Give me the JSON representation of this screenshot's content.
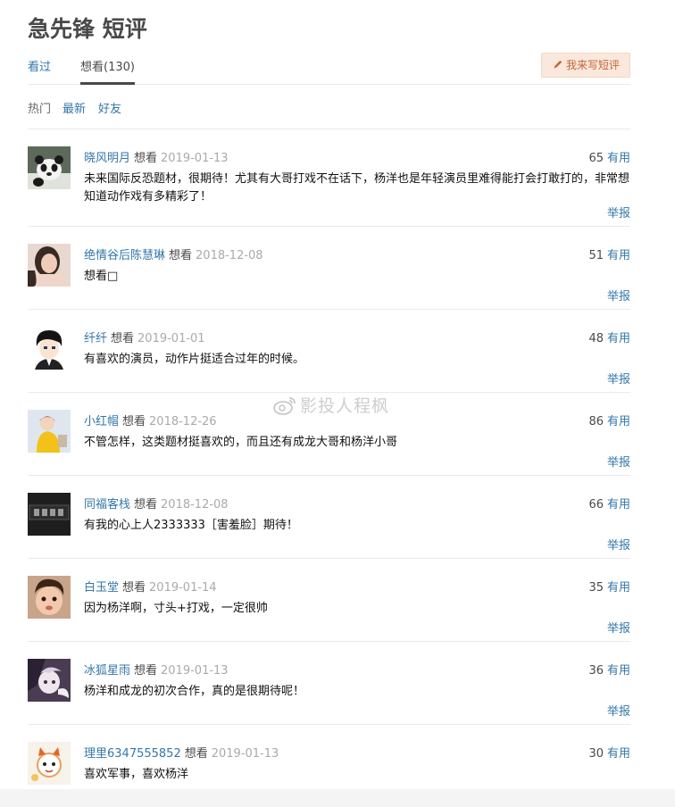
{
  "page": {
    "title": "急先锋 短评"
  },
  "tabs": [
    {
      "label": "看过",
      "active": false
    },
    {
      "label": "想看(130)",
      "active": true
    }
  ],
  "write_button": {
    "label": "我来写短评",
    "icon": "pencil-icon"
  },
  "sorts": [
    {
      "label": "热门",
      "active": true
    },
    {
      "label": "最新",
      "active": false
    },
    {
      "label": "好友",
      "active": false
    }
  ],
  "vote_label": "有用",
  "report_label": "举报",
  "watermark": {
    "text": "影投人程枫",
    "icon": "weibo-icon"
  },
  "comments": [
    {
      "user": "晓风明月",
      "status": "想看",
      "date": "2019-01-13",
      "votes": "65",
      "text": "未来国际反恐题材，很期待！尤其有大哥打戏不在话下，杨洋也是年轻演员里难得能打会打敢打的，非常想知道动作戏有多精彩了！",
      "avatar": "panda-avatar"
    },
    {
      "user": "绝情谷后陈慧琳",
      "status": "想看",
      "date": "2018-12-08",
      "votes": "51",
      "text": "想看□",
      "avatar": "woman-portrait-avatar"
    },
    {
      "user": "纤纤",
      "status": "想看",
      "date": "2019-01-01",
      "votes": "48",
      "text": "有喜欢的演员，动作片挺适合过年的时候。",
      "avatar": "anime-boy-avatar"
    },
    {
      "user": "小红帽",
      "status": "想看",
      "date": "2018-12-26",
      "votes": "86",
      "text": "不管怎样，这类题材挺喜欢的，而且还有成龙大哥和杨洋小哥",
      "avatar": "girl-yellow-avatar"
    },
    {
      "user": "同福客栈",
      "status": "想看",
      "date": "2018-12-08",
      "votes": "66",
      "text": "有我的心上人2333333［害羞脸］期待！",
      "avatar": "inn-sign-avatar"
    },
    {
      "user": "白玉堂",
      "status": "想看",
      "date": "2019-01-14",
      "votes": "35",
      "text": "因为杨洋啊，寸头+打戏，一定很帅",
      "avatar": "baby-avatar"
    },
    {
      "user": "冰狐星雨",
      "status": "想看",
      "date": "2019-01-13",
      "votes": "36",
      "text": "杨洋和成龙的初次合作，真的是很期待呢！",
      "avatar": "anime-fox-avatar"
    },
    {
      "user": "理里6347555852",
      "status": "想看",
      "date": "2019-01-13",
      "votes": "30",
      "text": "喜欢军事，喜欢杨洋",
      "avatar": "cartoon-cat-avatar"
    }
  ]
}
